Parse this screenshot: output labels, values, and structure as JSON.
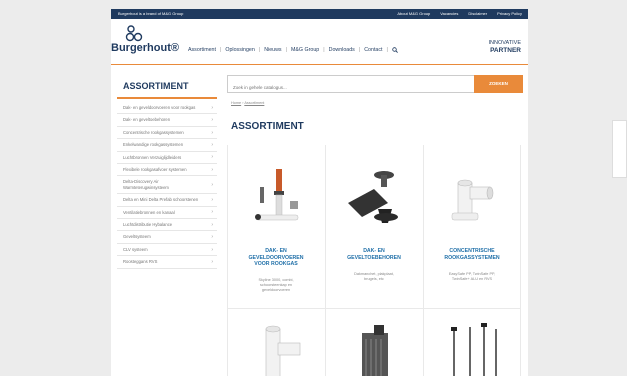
{
  "topbar": {
    "brandline": "Burgerhout is a brand of M&G Group",
    "links": [
      "About M&G Group",
      "Vacancies",
      "Disclaimer",
      "Privacy Policy"
    ]
  },
  "header": {
    "logo": "Burgerhout®",
    "nav": [
      "Assortiment",
      "Oplossingen",
      "Nieuws",
      "M&G Group",
      "Downloads",
      "Contact"
    ],
    "tagline_top": "INNOVATIVE",
    "tagline_bottom": "PARTNER"
  },
  "sidebar": {
    "title": "ASSORTIMENT",
    "items": [
      "Dak- en geveldoorvoeren voor rookgas",
      "Dak- en geveltoebehoren",
      "Concentrische rookgassystemen",
      "Enkelwandige rookgassystemen",
      "Luchtbronnen Verzuiglijdleiders",
      "Flexibele rookgasafvoer systemen",
      "Delta-Discovery Air Warmteterugwinsysteem",
      "Delta en Mini Delta Prefab schoorstenen",
      "Ventilatiebronnen en kanaal",
      "Luchtdistributie Hybalance",
      "Geveltsysteem",
      "CLV systeem",
      "Roosteggans RVS"
    ]
  },
  "search": {
    "placeholder": "Zoek in gehele catalogus...",
    "button": "ZOEKEN"
  },
  "breadcrumb": {
    "home": "Home",
    "sep": " › ",
    "current": "Assortiment"
  },
  "main": {
    "heading": "ASSORTIMENT"
  },
  "cards": [
    {
      "title_lines": [
        "DAK- EN",
        "GEVELDOORVOEREN",
        "VOOR ROOKGAS"
      ],
      "desc_lines": [
        "Skyline 3000, combi,",
        "schoorsteenkap en",
        "geveldoorvoeren"
      ]
    },
    {
      "title_lines": [
        "DAK- EN",
        "GEVELTOEBEHOREN"
      ],
      "desc_lines": [
        "Dakmanchet, plakplaat,",
        "brugels, etc"
      ]
    },
    {
      "title_lines": [
        "CONCENTRISCHE",
        "ROOKGASSYSTEMEN"
      ],
      "desc_lines": [
        "EasySafe PP, TwinSafe PP,",
        "TwinSafe+ ALU en RVS"
      ]
    }
  ],
  "colors": {
    "navy": "#1f3a5f",
    "orange": "#e98a3a",
    "link_blue": "#1f6fa8"
  }
}
